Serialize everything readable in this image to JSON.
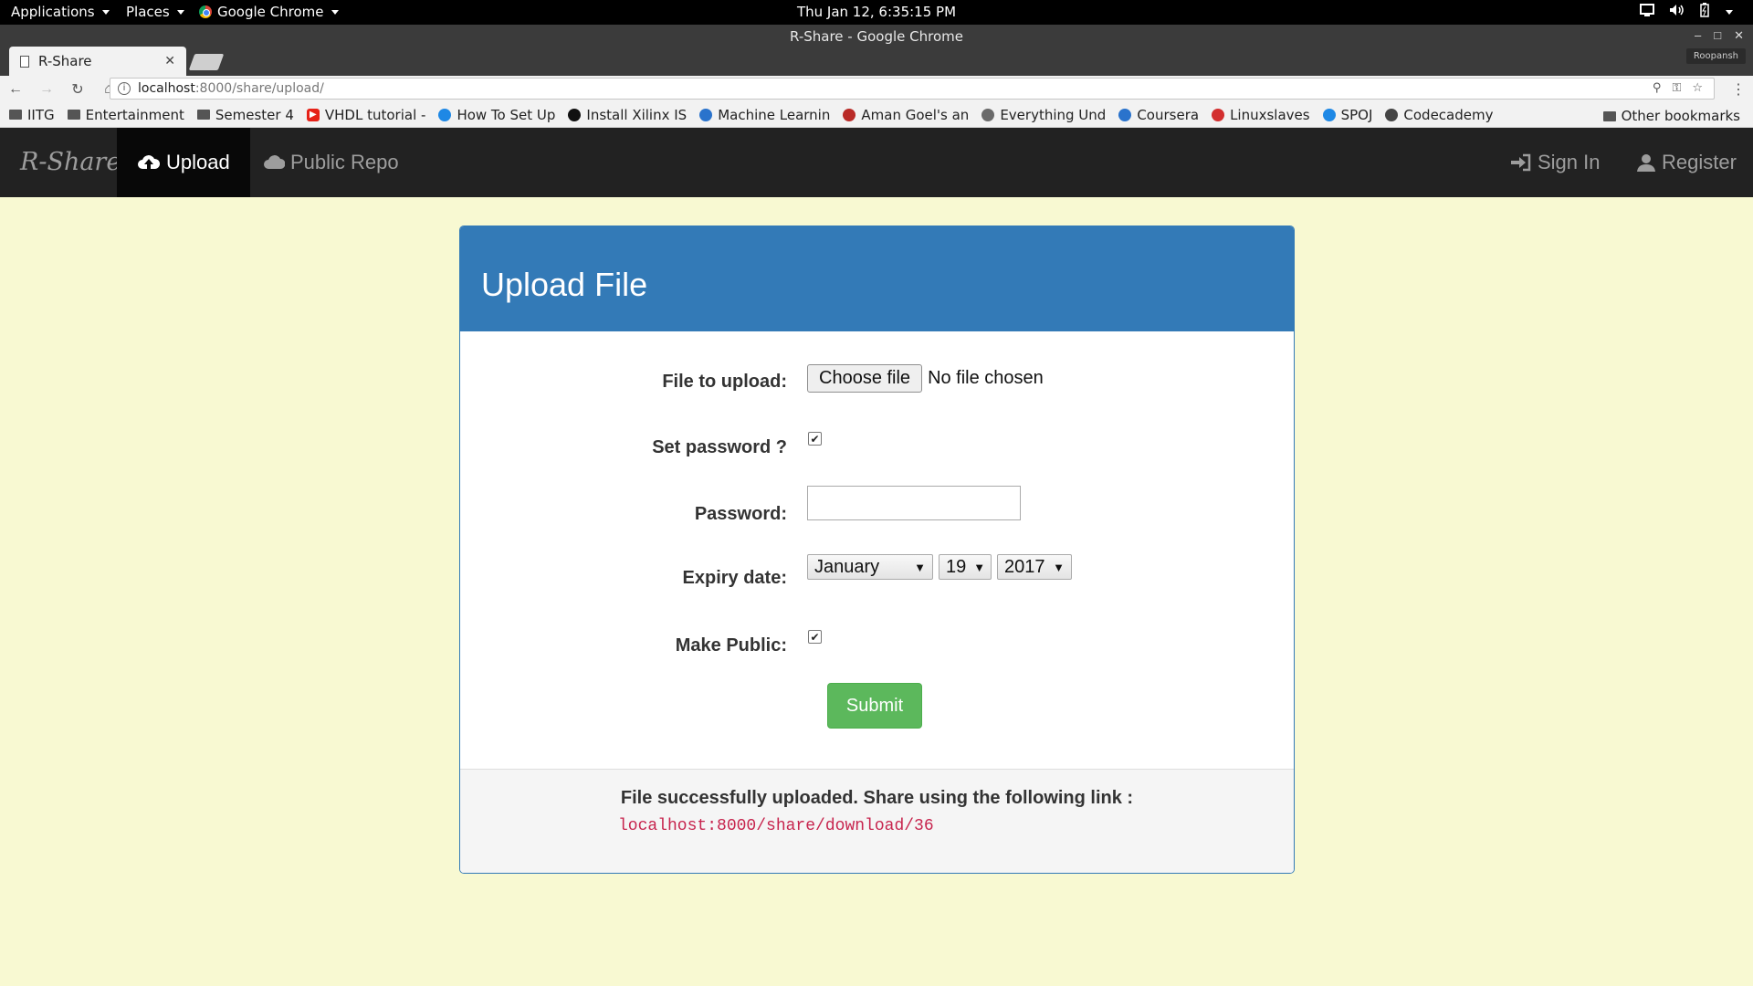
{
  "system": {
    "applications": "Applications",
    "places": "Places",
    "app_name": "Google Chrome",
    "clock": "Thu Jan 12,  6:35:15 PM"
  },
  "window": {
    "title": "R-Share - Google Chrome",
    "profile": "Roopansh",
    "tab_title": "R-Share"
  },
  "address": {
    "host": "localhost",
    "path": ":8000/share/upload/"
  },
  "bookmarks": [
    {
      "label": "IITG",
      "kind": "folder"
    },
    {
      "label": "Entertainment",
      "kind": "folder"
    },
    {
      "label": "Semester 4",
      "kind": "folder"
    },
    {
      "label": "VHDL tutorial -",
      "kind": "youtube",
      "color": "#e62117"
    },
    {
      "label": "How To Set Up",
      "kind": "site",
      "color": "#1e88e5"
    },
    {
      "label": "Install Xilinx IS",
      "kind": "site",
      "color": "#111111"
    },
    {
      "label": "Machine Learnin",
      "kind": "site",
      "color": "#2a73cc"
    },
    {
      "label": "Aman Goel's an",
      "kind": "site",
      "color": "#b92b27"
    },
    {
      "label": "Everything Und",
      "kind": "site",
      "color": "#6a6a6a"
    },
    {
      "label": "Coursera",
      "kind": "site",
      "color": "#2a73cc"
    },
    {
      "label": "Linuxslaves",
      "kind": "site",
      "color": "#d32f2f"
    },
    {
      "label": "SPOJ",
      "kind": "site",
      "color": "#1e88e5"
    },
    {
      "label": "Codecademy",
      "kind": "site",
      "color": "#444444"
    }
  ],
  "other_bookmarks": "Other bookmarks",
  "site": {
    "brand": "R-Share",
    "nav": {
      "upload": "Upload",
      "public_repo": "Public Repo",
      "sign_in": "Sign In",
      "register": "Register"
    },
    "colors": {
      "navbar": "#222222",
      "panel": "#337ab7",
      "submit": "#5cb85c",
      "background": "#f8f9d2"
    }
  },
  "form": {
    "heading": "Upload File",
    "file_label": "File to upload:",
    "file_button": "Choose file",
    "file_status": "No file chosen",
    "set_password_label": "Set password ?",
    "set_password_checked": true,
    "password_label": "Password:",
    "password_value": "",
    "expiry_label": "Expiry date:",
    "expiry_month": "January",
    "expiry_day": "19",
    "expiry_year": "2017",
    "make_public_label": "Make Public:",
    "make_public_checked": true,
    "submit_label": "Submit"
  },
  "result": {
    "message": "File successfully uploaded. Share using the following link :",
    "link": "localhost:8000/share/download/36"
  }
}
